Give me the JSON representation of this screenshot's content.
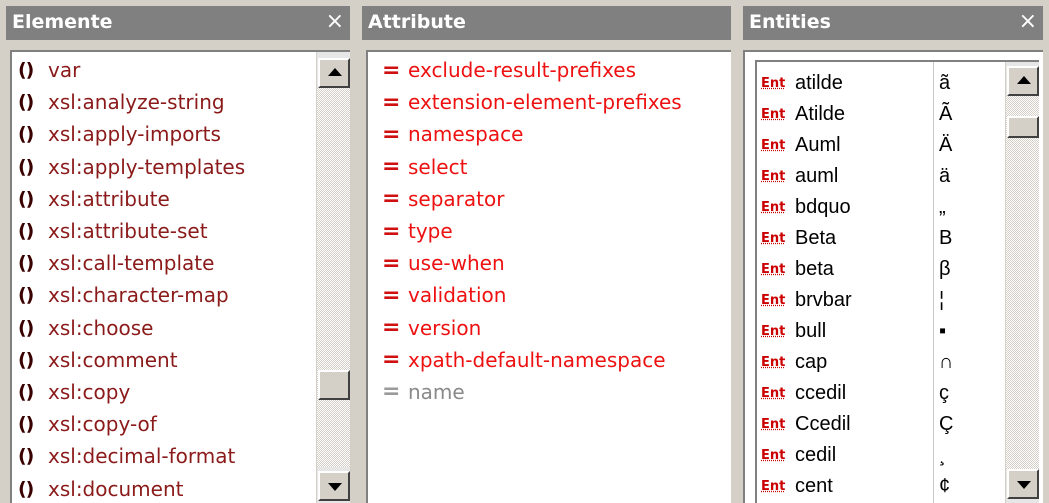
{
  "elements_pane": {
    "title": "Elemente",
    "close": "×",
    "icon_glyph": "()",
    "items": [
      "var",
      "xsl:analyze-string",
      "xsl:apply-imports",
      "xsl:apply-templates",
      "xsl:attribute",
      "xsl:attribute-set",
      "xsl:call-template",
      "xsl:character-map",
      "xsl:choose",
      "xsl:comment",
      "xsl:copy",
      "xsl:copy-of",
      "xsl:decimal-format",
      "xsl:document"
    ]
  },
  "attributes_pane": {
    "title": "Attribute",
    "eq_glyph": "=",
    "items": [
      {
        "label": "exclude-result-prefixes",
        "state": "active"
      },
      {
        "label": "extension-element-prefixes",
        "state": "active"
      },
      {
        "label": "namespace",
        "state": "active"
      },
      {
        "label": "select",
        "state": "active"
      },
      {
        "label": "separator",
        "state": "active"
      },
      {
        "label": "type",
        "state": "active"
      },
      {
        "label": "use-when",
        "state": "active"
      },
      {
        "label": "validation",
        "state": "active"
      },
      {
        "label": "version",
        "state": "active"
      },
      {
        "label": "xpath-default-namespace",
        "state": "active"
      },
      {
        "label": "name",
        "state": "disabled"
      }
    ]
  },
  "entities_pane": {
    "title": "Entities",
    "close": "×",
    "badge": "Ent",
    "items": [
      {
        "name": "atilde",
        "char": "ã"
      },
      {
        "name": "Atilde",
        "char": "Ã"
      },
      {
        "name": "Auml",
        "char": "Ä"
      },
      {
        "name": "auml",
        "char": "ä"
      },
      {
        "name": "bdquo",
        "char": "„"
      },
      {
        "name": "Beta",
        "char": "Β"
      },
      {
        "name": "beta",
        "char": "β"
      },
      {
        "name": "brvbar",
        "char": "¦"
      },
      {
        "name": "bull",
        "char": "▪"
      },
      {
        "name": "cap",
        "char": "∩"
      },
      {
        "name": "ccedil",
        "char": "ç"
      },
      {
        "name": "Ccedil",
        "char": "Ç"
      },
      {
        "name": "cedil",
        "char": "¸"
      },
      {
        "name": "cent",
        "char": "¢"
      }
    ]
  },
  "colors": {
    "element_text": "#8b1a1a",
    "attribute_text": "#ee1111",
    "attribute_disabled": "#8a8a8a",
    "title_bar": "#808080",
    "entity_badge": "#cc0000"
  }
}
